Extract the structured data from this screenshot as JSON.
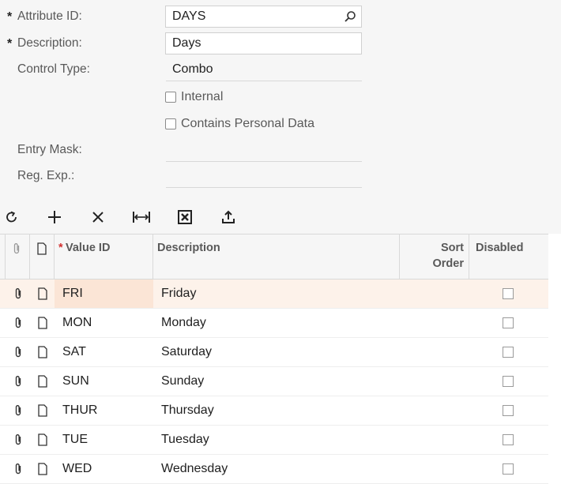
{
  "form": {
    "attribute_id": {
      "label": "Attribute ID:",
      "value": "DAYS",
      "required_mark": "*"
    },
    "description": {
      "label": "Description:",
      "value": "Days",
      "required_mark": "*"
    },
    "control_type": {
      "label": "Control Type:",
      "value": "Combo"
    },
    "internal": {
      "label": "Internal",
      "checked": false
    },
    "personal_data": {
      "label": "Contains Personal Data",
      "checked": false
    },
    "entry_mask": {
      "label": "Entry Mask:",
      "value": ""
    },
    "reg_exp": {
      "label": "Reg. Exp.:",
      "value": ""
    }
  },
  "toolbar": {
    "icons": [
      "refresh-icon",
      "add-icon",
      "delete-icon",
      "fit-width-icon",
      "excel-export-icon",
      "upload-icon"
    ]
  },
  "grid": {
    "headers": {
      "value_id": "Value ID",
      "value_id_required": "*",
      "description": "Description",
      "sort_order_line1": "Sort",
      "sort_order_line2": "Order",
      "disabled": "Disabled"
    },
    "rows": [
      {
        "value_id": "FRI",
        "description": "Friday",
        "disabled": false
      },
      {
        "value_id": "MON",
        "description": "Monday",
        "disabled": false
      },
      {
        "value_id": "SAT",
        "description": "Saturday",
        "disabled": false
      },
      {
        "value_id": "SUN",
        "description": "Sunday",
        "disabled": false
      },
      {
        "value_id": "THUR",
        "description": "Thursday",
        "disabled": false
      },
      {
        "value_id": "TUE",
        "description": "Tuesday",
        "disabled": false
      },
      {
        "value_id": "WED",
        "description": "Wednesday",
        "disabled": false
      }
    ],
    "selected_row": 0
  },
  "colors": {
    "selected_row": "#fdf2ea",
    "panel": "#f6f6f6"
  }
}
